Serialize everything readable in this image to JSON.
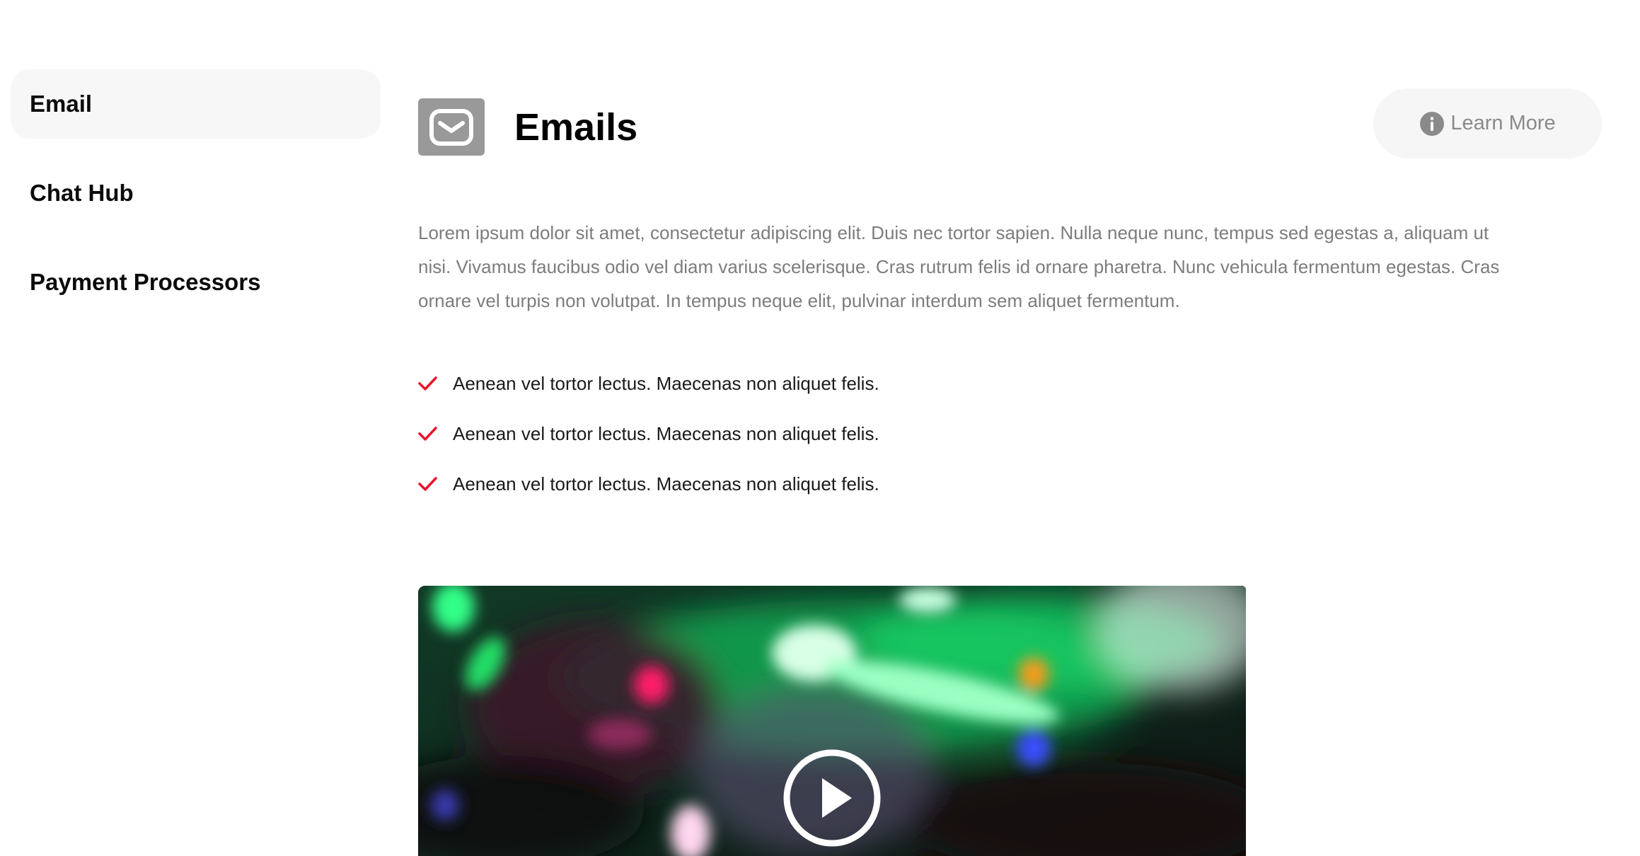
{
  "sidebar": {
    "items": [
      {
        "label": "Email",
        "active": true
      },
      {
        "label": "Chat Hub",
        "active": false
      },
      {
        "label": "Payment Processors",
        "active": false
      }
    ]
  },
  "header": {
    "icon": "envelope-icon",
    "title": "Emails",
    "learn_more": {
      "label": "Learn More",
      "icon": "info-icon"
    }
  },
  "description": "Lorem ipsum dolor sit amet, consectetur adipiscing elit. Duis nec tortor sapien. Nulla neque nunc, tempus sed egestas a, aliquam ut nisi. Vivamus faucibus odio vel diam varius scelerisque. Cras rutrum felis id ornare pharetra. Nunc vehicula fermentum egestas. Cras ornare vel turpis non volutpat. In tempus neque elit, pulvinar interdum sem aliquet fermentum.",
  "features": [
    {
      "text": "Aenean vel tortor lectus. Maecenas non aliquet felis.",
      "icon": "check-icon"
    },
    {
      "text": "Aenean vel tortor lectus. Maecenas non aliquet felis.",
      "icon": "check-icon"
    },
    {
      "text": "Aenean vel tortor lectus. Maecenas non aliquet felis.",
      "icon": "check-icon"
    }
  ],
  "video": {
    "play_icon": "play-icon"
  },
  "colors": {
    "accent_check": "#e8132c",
    "icon_tile": "#999999",
    "sidebar_active_bg": "#f7f7f7",
    "learn_more_bg": "#f6f6f6",
    "muted_text": "#7d7d7d"
  }
}
